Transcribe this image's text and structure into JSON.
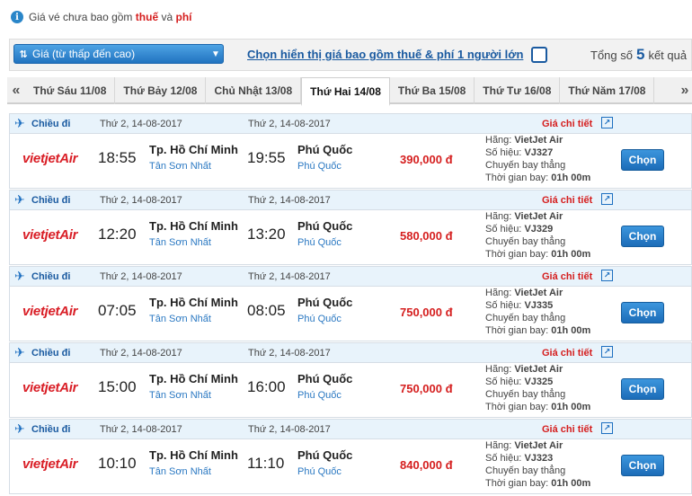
{
  "notice": {
    "prefix": "Giá vé chưa bao gồm",
    "tax": "thuế",
    "and": "và",
    "fee": "phí"
  },
  "toolbar": {
    "sort_label": "Giá (từ thấp đến cao)",
    "include_link": "Chọn hiển thị giá bao gồm thuế & phí 1 người lớn",
    "total_prefix": "Tổng số",
    "total_count": "5",
    "total_suffix": "kết quả"
  },
  "date_tabs": [
    {
      "label": "Thứ Sáu 11/08",
      "active": false
    },
    {
      "label": "Thứ Bảy 12/08",
      "active": false
    },
    {
      "label": "Chủ Nhật 13/08",
      "active": false
    },
    {
      "label": "Thứ Hai 14/08",
      "active": true
    },
    {
      "label": "Thứ Ba 15/08",
      "active": false
    },
    {
      "label": "Thứ Tư 16/08",
      "active": false
    },
    {
      "label": "Thứ Năm 17/08",
      "active": false
    }
  ],
  "nav": {
    "prev": "«",
    "next": "»"
  },
  "labels": {
    "direction": "Chiều đi",
    "detail": "Giá chi tiết",
    "airline_label": "Hãng:",
    "flight_no_label": "Số hiệu:",
    "duration_label": "Thời gian bay:",
    "choose": "Chọn"
  },
  "colors": {
    "accent_blue": "#1a5aa0",
    "price_red": "#d51e1e",
    "header_bg": "#e8f3fb",
    "logo_red": "#d91e26"
  },
  "results": [
    {
      "logo": "vietjetAir",
      "dep_date": "Thứ 2, 14-08-2017",
      "arr_date": "Thứ 2, 14-08-2017",
      "dep_time": "18:55",
      "dep_city": "Tp. Hồ Chí Minh",
      "dep_airport": "Tân Sơn Nhất",
      "arr_time": "19:55",
      "arr_city": "Phú Quốc",
      "arr_airport": "Phú Quốc",
      "price": "390,000 đ",
      "airline": "VietJet Air",
      "flight_no": "VJ327",
      "type": "Chuyến bay thẳng",
      "duration": "01h 00m"
    },
    {
      "logo": "vietjetAir",
      "dep_date": "Thứ 2, 14-08-2017",
      "arr_date": "Thứ 2, 14-08-2017",
      "dep_time": "12:20",
      "dep_city": "Tp. Hồ Chí Minh",
      "dep_airport": "Tân Sơn Nhất",
      "arr_time": "13:20",
      "arr_city": "Phú Quốc",
      "arr_airport": "Phú Quốc",
      "price": "580,000 đ",
      "airline": "VietJet Air",
      "flight_no": "VJ329",
      "type": "Chuyến bay thẳng",
      "duration": "01h 00m"
    },
    {
      "logo": "vietjetAir",
      "dep_date": "Thứ 2, 14-08-2017",
      "arr_date": "Thứ 2, 14-08-2017",
      "dep_time": "07:05",
      "dep_city": "Tp. Hồ Chí Minh",
      "dep_airport": "Tân Sơn Nhất",
      "arr_time": "08:05",
      "arr_city": "Phú Quốc",
      "arr_airport": "Phú Quốc",
      "price": "750,000 đ",
      "airline": "VietJet Air",
      "flight_no": "VJ335",
      "type": "Chuyến bay thẳng",
      "duration": "01h 00m"
    },
    {
      "logo": "vietjetAir",
      "dep_date": "Thứ 2, 14-08-2017",
      "arr_date": "Thứ 2, 14-08-2017",
      "dep_time": "15:00",
      "dep_city": "Tp. Hồ Chí Minh",
      "dep_airport": "Tân Sơn Nhất",
      "arr_time": "16:00",
      "arr_city": "Phú Quốc",
      "arr_airport": "Phú Quốc",
      "price": "750,000 đ",
      "airline": "VietJet Air",
      "flight_no": "VJ325",
      "type": "Chuyến bay thẳng",
      "duration": "01h 00m"
    },
    {
      "logo": "vietjetAir",
      "dep_date": "Thứ 2, 14-08-2017",
      "arr_date": "Thứ 2, 14-08-2017",
      "dep_time": "10:10",
      "dep_city": "Tp. Hồ Chí Minh",
      "dep_airport": "Tân Sơn Nhất",
      "arr_time": "11:10",
      "arr_city": "Phú Quốc",
      "arr_airport": "Phú Quốc",
      "price": "840,000 đ",
      "airline": "VietJet Air",
      "flight_no": "VJ323",
      "type": "Chuyến bay thẳng",
      "duration": "01h 00m"
    }
  ]
}
